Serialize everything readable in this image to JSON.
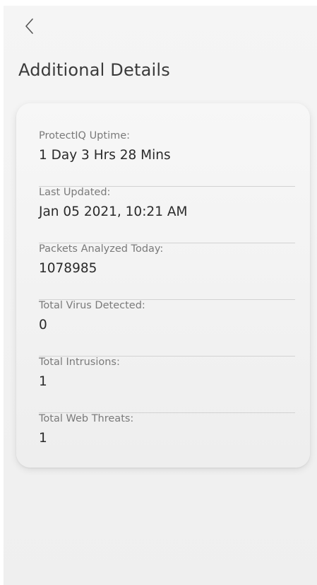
{
  "header": {
    "back_icon": "chevron-left-icon",
    "title": "Additional Details"
  },
  "details": [
    {
      "label": "ProtectIQ Uptime:",
      "value": "1 Day 3 Hrs 28 Mins"
    },
    {
      "label": "Last Updated:",
      "value": "Jan 05 2021, 10:21 AM"
    },
    {
      "label": "Packets Analyzed Today:",
      "value": "1078985"
    },
    {
      "label": "Total Virus Detected:",
      "value": "0"
    },
    {
      "label": "Total Intrusions:",
      "value": "1"
    },
    {
      "label": "Total Web Threats:",
      "value": "1"
    }
  ],
  "colors": {
    "background": "#f2f2f2",
    "card": "#f4f4f4",
    "label": "#7a7a7a",
    "value": "#2a2a2a",
    "divider": "#d2d2d2"
  }
}
